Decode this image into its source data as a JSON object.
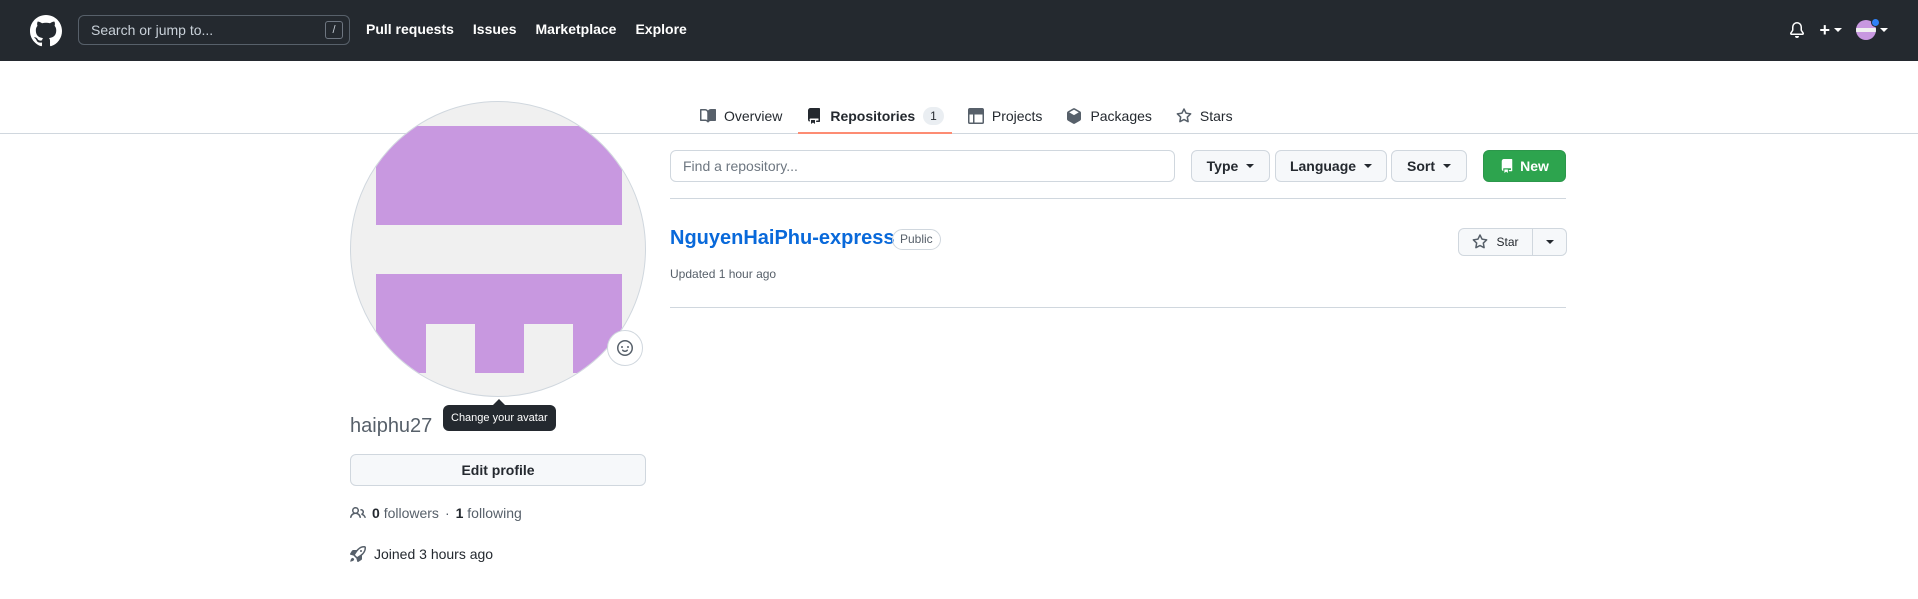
{
  "header": {
    "search_placeholder": "Search or jump to...",
    "search_shortcut": "/",
    "nav": [
      "Pull requests",
      "Issues",
      "Marketplace",
      "Explore"
    ],
    "plus_label": "+"
  },
  "tabs": [
    {
      "label": "Overview",
      "icon": "book-icon"
    },
    {
      "label": "Repositories",
      "icon": "repo-icon",
      "count": "1",
      "active": true
    },
    {
      "label": "Projects",
      "icon": "table-icon"
    },
    {
      "label": "Packages",
      "icon": "package-icon"
    },
    {
      "label": "Stars",
      "icon": "star-icon"
    }
  ],
  "profile": {
    "tooltip": "Change your avatar",
    "username": "haiphu27",
    "edit_label": "Edit profile",
    "followers_count": "0",
    "followers_label": "followers",
    "separator": "·",
    "following_count": "1",
    "following_label": "following",
    "joined": "Joined 3 hours ago",
    "avatar_color": "#c898e0"
  },
  "repos_toolbar": {
    "find_placeholder": "Find a repository...",
    "type_label": "Type",
    "language_label": "Language",
    "sort_label": "Sort",
    "new_label": "New",
    "new_color": "#2da44e"
  },
  "repositories": [
    {
      "name": "NguyenHaiPhu-express",
      "visibility": "Public",
      "updated": "Updated 1 hour ago",
      "star_label": "Star"
    }
  ],
  "colors": {
    "header_bg": "#24292f",
    "link": "#0969da",
    "tab_underline": "#fd8c73"
  }
}
